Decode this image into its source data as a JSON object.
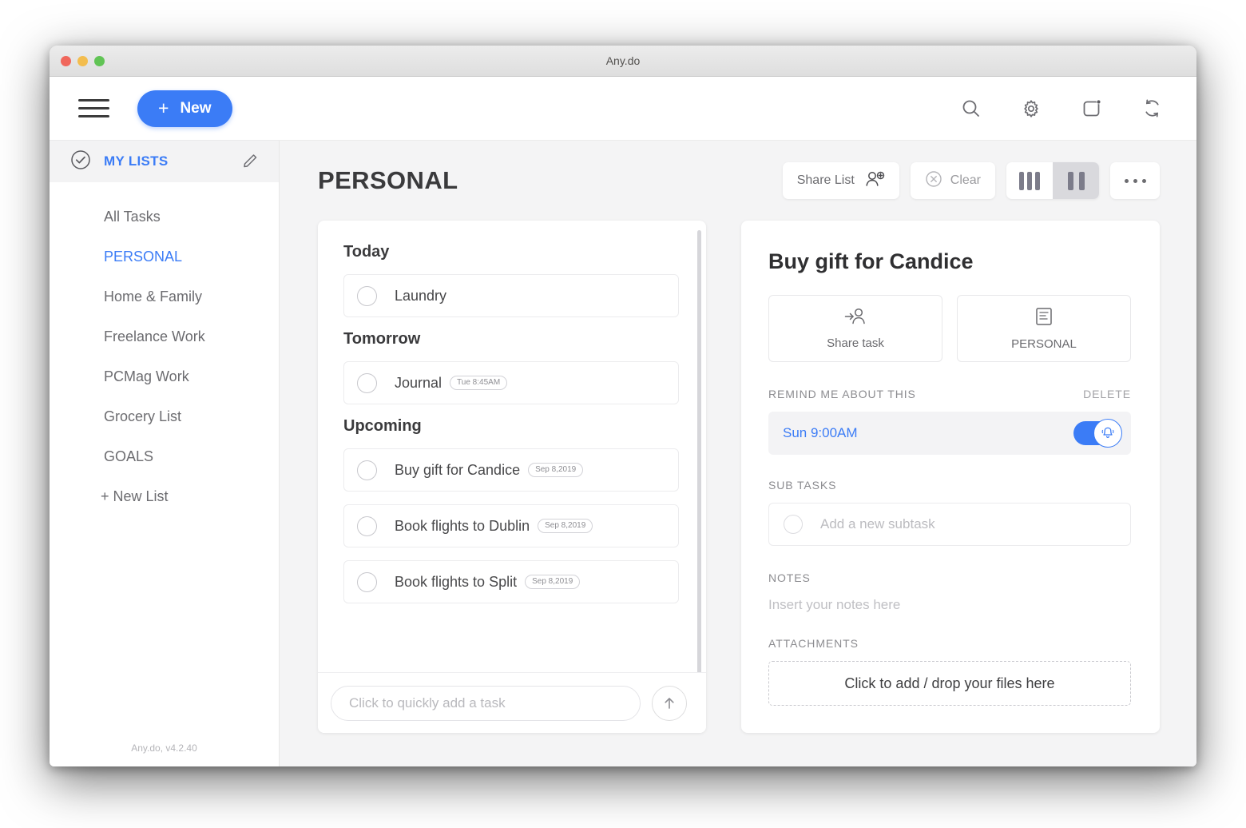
{
  "window": {
    "title": "Any.do"
  },
  "toolbar": {
    "new_label": "New",
    "plus": "+",
    "icons": [
      "search-icon",
      "gear-icon",
      "notification-icon",
      "sync-icon"
    ]
  },
  "sidebar": {
    "header_label": "MY LISTS",
    "items": [
      {
        "label": "All Tasks",
        "active": false
      },
      {
        "label": "PERSONAL",
        "active": true
      },
      {
        "label": "Home & Family",
        "active": false
      },
      {
        "label": "Freelance Work",
        "active": false
      },
      {
        "label": "PCMag Work",
        "active": false
      },
      {
        "label": "Grocery List",
        "active": false
      },
      {
        "label": "GOALS",
        "active": false
      }
    ],
    "new_list_label": "+ New List",
    "version": "Any.do, v4.2.40"
  },
  "main": {
    "page_title": "PERSONAL",
    "share_list_label": "Share List",
    "clear_label": "Clear",
    "sections": [
      {
        "title": "Today",
        "tasks": [
          {
            "text": "Laundry",
            "badge": ""
          }
        ]
      },
      {
        "title": "Tomorrow",
        "tasks": [
          {
            "text": "Journal",
            "badge": "Tue 8:45AM"
          }
        ]
      },
      {
        "title": "Upcoming",
        "tasks": [
          {
            "text": "Buy gift for Candice",
            "badge": "Sep 8,2019"
          },
          {
            "text": "Book flights to Dublin",
            "badge": "Sep 8,2019"
          },
          {
            "text": "Book flights to Split",
            "badge": "Sep 8,2019"
          }
        ]
      }
    ],
    "quick_add_placeholder": "Click to quickly add a task"
  },
  "detail": {
    "title": "Buy gift for Candice",
    "share_task_label": "Share task",
    "list_label": "PERSONAL",
    "remind_label": "REMIND ME ABOUT THIS",
    "delete_label": "DELETE",
    "reminder_time": "Sun 9:00AM",
    "subtasks_label": "SUB TASKS",
    "subtask_placeholder": "Add a new subtask",
    "notes_label": "NOTES",
    "notes_placeholder": "Insert your notes here",
    "attachments_label": "ATTACHMENTS",
    "dropzone_label": "Click to add / drop your files here"
  },
  "colors": {
    "accent": "#3b7cf6",
    "text": "#48484a",
    "muted": "#8e8e93",
    "bg": "#f4f4f5"
  }
}
